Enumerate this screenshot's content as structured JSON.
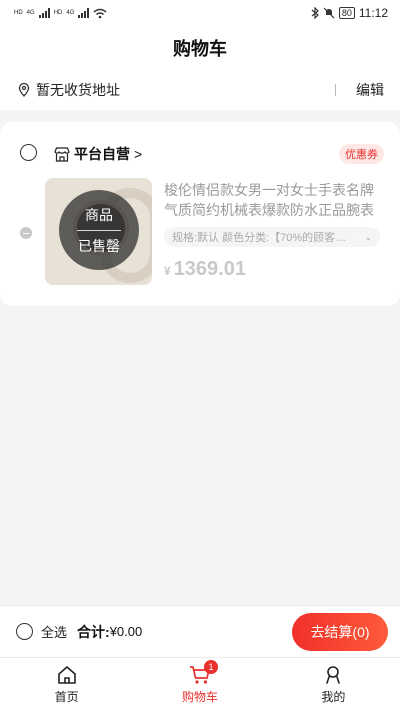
{
  "status_bar": {
    "time": "11:12",
    "battery": "80",
    "network_labels": [
      "HD",
      "4G",
      "HD",
      "4G"
    ]
  },
  "header": {
    "title": "购物车"
  },
  "address": {
    "text": "暂无收货地址",
    "edit_label": "编辑"
  },
  "shop": {
    "name": "平台自营",
    "coupon_label": "优惠券",
    "item": {
      "image_overlay_line1": "商品",
      "image_overlay_line2": "已售罄",
      "title": "梭伦情侣款女男一对女士手表名牌气质简约机械表爆款防水正品腕表",
      "spec": "规格:默认  颜色分类:【70%的顾客…",
      "currency": "¥",
      "price": "1369.01"
    }
  },
  "checkout": {
    "select_all_label": "全选",
    "total_label": "合计:",
    "total_value": "¥0.00",
    "pay_button": "去结算(0)"
  },
  "tabbar": {
    "items": [
      {
        "label": "首页",
        "icon": "home-icon"
      },
      {
        "label": "购物车",
        "icon": "cart-icon",
        "badge": "1"
      },
      {
        "label": "我的",
        "icon": "profile-icon"
      }
    ]
  },
  "colors": {
    "accent": "#e8302c",
    "background": "#f4f4f4"
  }
}
